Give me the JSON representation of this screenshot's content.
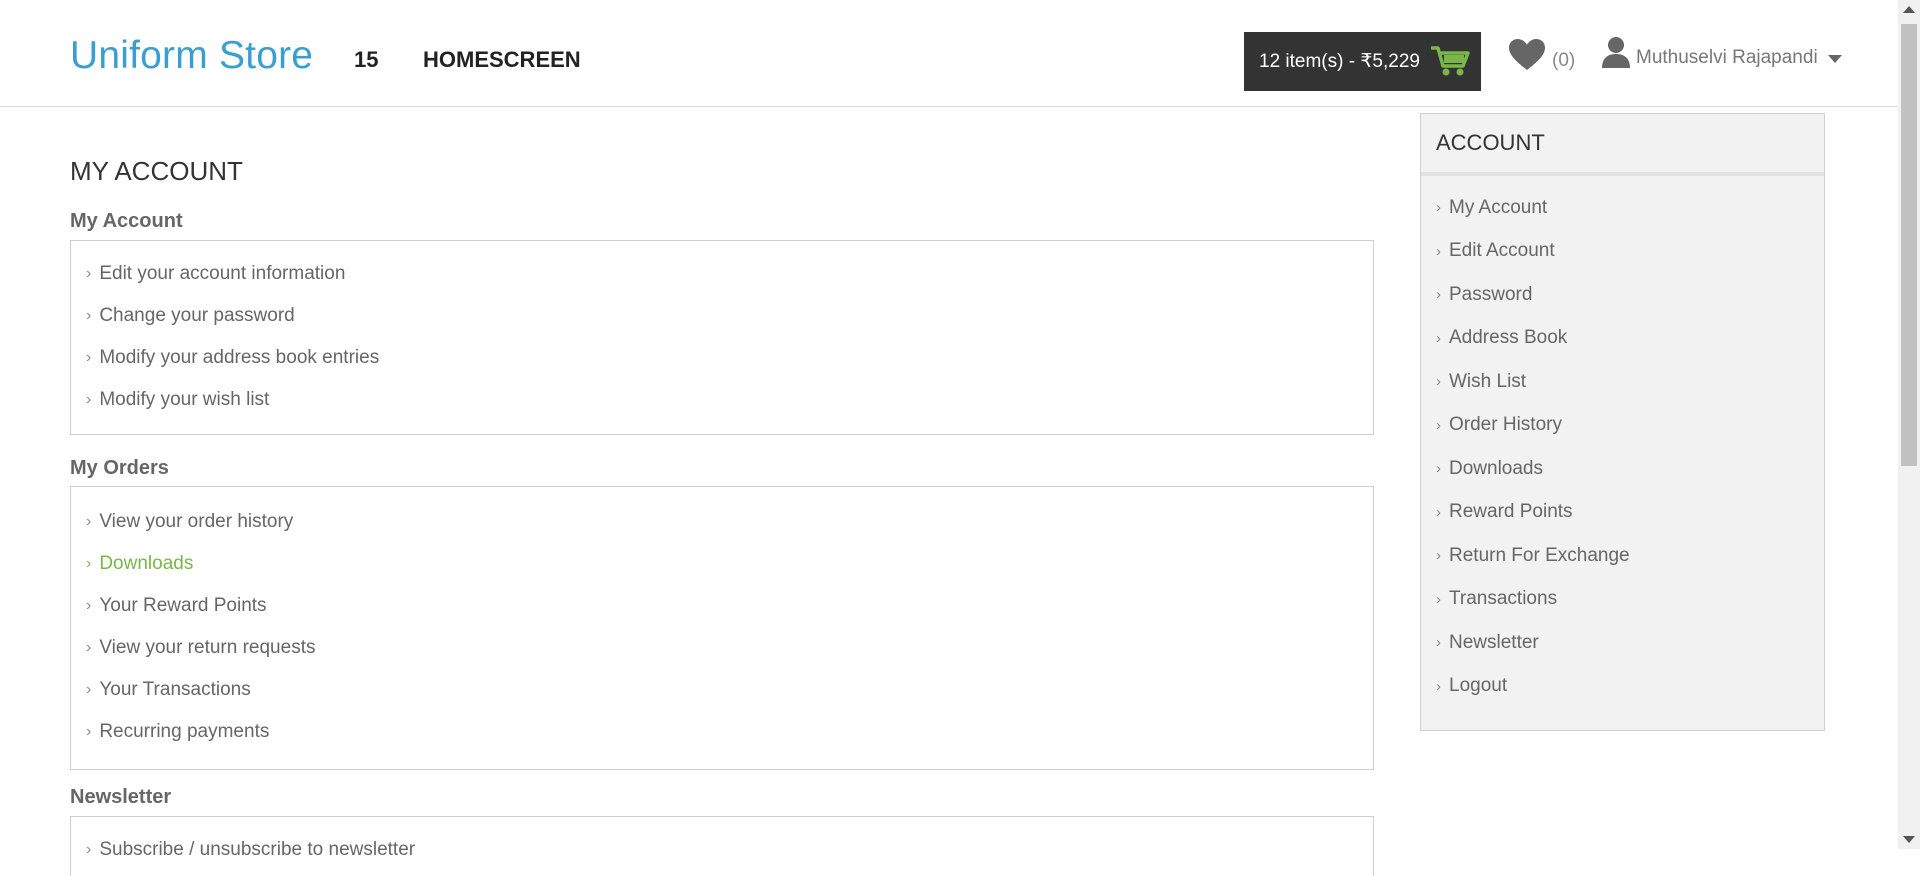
{
  "header": {
    "logo": "Uniform Store",
    "nav_number": "15",
    "nav_home": "HOMESCREEN",
    "cart_label": "12 item(s) - ₹5,229",
    "wishlist_count": "(0)",
    "user_name": "Muthuselvi Rajapandi"
  },
  "main": {
    "page_title": "MY ACCOUNT",
    "sections": [
      {
        "title": "My Account",
        "items": [
          "Edit your account information",
          "Change your password",
          "Modify your address book entries",
          "Modify your wish list"
        ]
      },
      {
        "title": "My Orders",
        "items": [
          "View your order history",
          "Downloads",
          "Your Reward Points",
          "View your return requests",
          "Your Transactions",
          "Recurring payments"
        ]
      },
      {
        "title": "Newsletter",
        "items": [
          "Subscribe / unsubscribe to newsletter"
        ]
      }
    ]
  },
  "sidebar": {
    "heading": "ACCOUNT",
    "items": [
      "My Account",
      "Edit Account",
      "Password",
      "Address Book",
      "Wish List",
      "Order History",
      "Downloads",
      "Reward Points",
      "Return For Exchange",
      "Transactions",
      "Newsletter",
      "Logout"
    ]
  },
  "colors": {
    "logo": "#3a9fd0",
    "active_link": "#7ab648",
    "cart_bg": "#333333",
    "cart_icon": "#7ab648"
  }
}
